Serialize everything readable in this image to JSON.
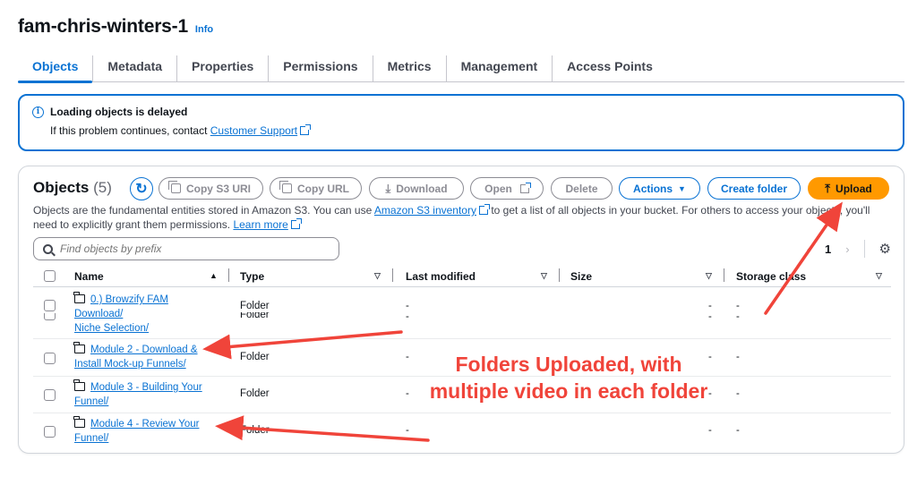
{
  "bucket": {
    "name": "fam-chris-winters-1",
    "info_label": "Info"
  },
  "tabs": [
    {
      "label": "Objects",
      "active": true
    },
    {
      "label": "Metadata"
    },
    {
      "label": "Properties"
    },
    {
      "label": "Permissions"
    },
    {
      "label": "Metrics"
    },
    {
      "label": "Management"
    },
    {
      "label": "Access Points"
    }
  ],
  "alert": {
    "title": "Loading objects is delayed",
    "body_prefix": "If this problem continues, contact ",
    "link_label": "Customer Support"
  },
  "objects": {
    "title": "Objects",
    "count": "(5)",
    "toolbar": {
      "copy_s3_uri": "Copy S3 URI",
      "copy_url": "Copy URL",
      "download": "Download",
      "open": "Open",
      "delete": "Delete",
      "actions": "Actions",
      "create_folder": "Create folder",
      "upload": "Upload"
    },
    "description": {
      "part1": "Objects are the fundamental entities stored in Amazon S3. You can use ",
      "inventory_link": "Amazon S3 inventory",
      "part2": " to get a list of all objects in your bucket. For others to access your objects, you'll need to explicitly grant them permissions. ",
      "learn_more": "Learn more"
    },
    "search_placeholder": "Find objects by prefix",
    "pagination": {
      "current_page": "1"
    },
    "columns": [
      "Name",
      "Type",
      "Last modified",
      "Size",
      "Storage class"
    ],
    "rows": [
      {
        "name_line1": "0.) Browzify FAM",
        "name_line2": "Download/",
        "type": "Folder",
        "last_modified": "-",
        "size": "-",
        "storage_class": "-"
      },
      {
        "name_line1": "Niche Selection/",
        "type": "Folder",
        "last_modified": "-",
        "size": "-",
        "storage_class": "-"
      },
      {
        "name_line1": "Module 2 - Download &",
        "name_line2": "Install Mock-up Funnels/",
        "type": "Folder",
        "last_modified": "-",
        "size": "-",
        "storage_class": "-"
      },
      {
        "name_line1": "Module 3 - Building Your",
        "name_line2": "Funnel/",
        "type": "Folder",
        "last_modified": "-",
        "size": "-",
        "storage_class": "-"
      },
      {
        "name_line1": "Module 4 - Review Your",
        "name_line2": "Funnel/",
        "type": "Folder",
        "last_modified": "-",
        "size": "-",
        "storage_class": "-"
      }
    ]
  },
  "annotation": {
    "line1": "Folders Uploaded, with",
    "line2": "multiple video in each folder",
    "color": "#f0443a"
  },
  "colors": {
    "accent": "#0972d3",
    "upload": "#ff9900"
  }
}
